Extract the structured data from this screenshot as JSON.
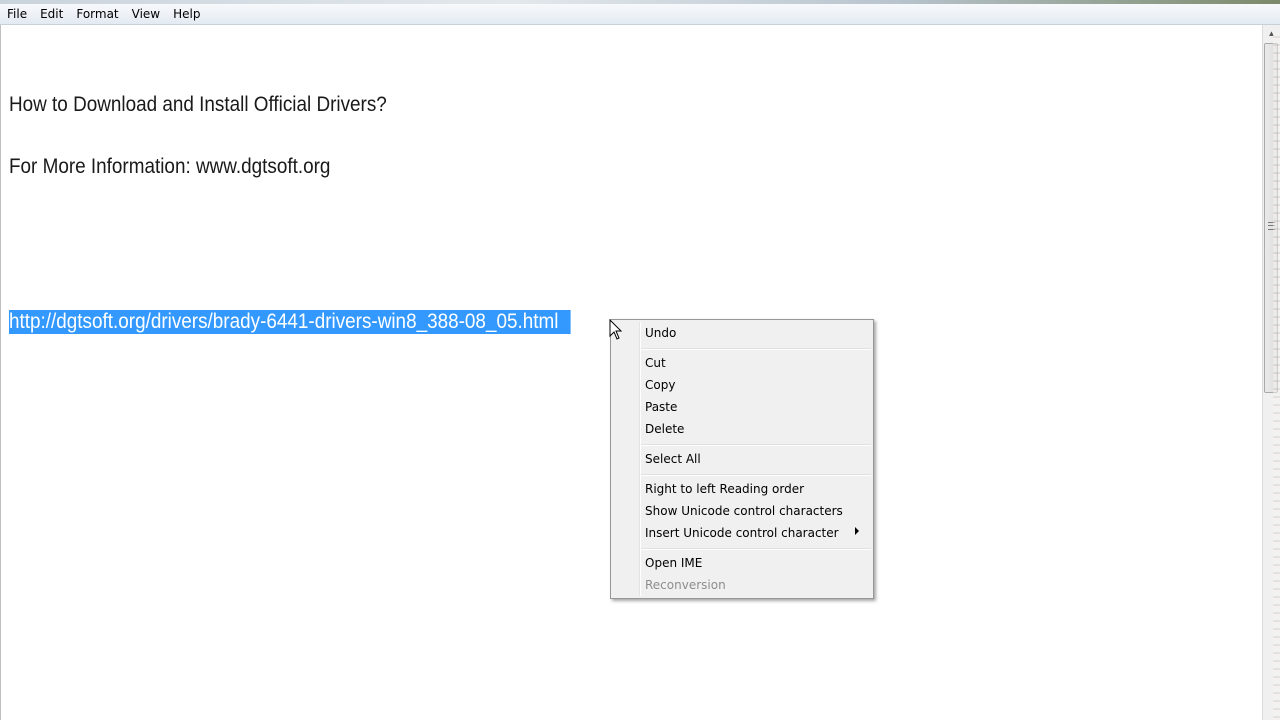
{
  "menubar": {
    "items": [
      "File",
      "Edit",
      "Format",
      "View",
      "Help"
    ]
  },
  "document": {
    "lines": [
      "How to Download and Install Official Drivers?",
      "For More Information: www.dgtsoft.org",
      "http://dgtsoft.org/drivers/brady-6441-drivers-win8_388-08_05.html"
    ],
    "selection_color": "#3399ff"
  },
  "context_menu": {
    "undo": "Undo",
    "cut": "Cut",
    "copy": "Copy",
    "paste": "Paste",
    "delete": "Delete",
    "select_all": "Select All",
    "rtl": "Right to left Reading order",
    "show_unicode": "Show Unicode control characters",
    "insert_unicode": "Insert Unicode control character",
    "open_ime": "Open IME",
    "reconversion": "Reconversion",
    "submenu_icon": "chevron-right-icon"
  }
}
